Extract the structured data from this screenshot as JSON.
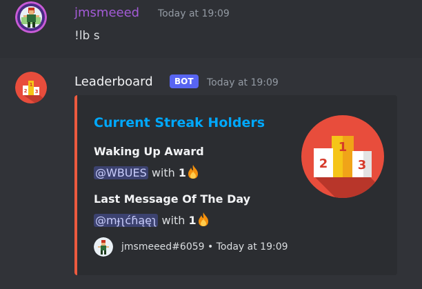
{
  "messages": [
    {
      "author": "jmsmeeed",
      "timestamp": "Today at 19:09",
      "content": "!lb s",
      "author_color": "#a35bd6"
    },
    {
      "author": "Leaderboard",
      "badge": "BOT",
      "timestamp": "Today at 19:09",
      "embed": {
        "accent_color": "#ed5a3f",
        "title": "Current Streak Holders",
        "fields": [
          {
            "name": "Waking Up Award",
            "mention": "@WBUES",
            "with_text": "with",
            "count": "1"
          },
          {
            "name": "Last Message Of The Day",
            "mention": "@mɟʅćɦąęʅ",
            "with_text": "with",
            "count": "1"
          }
        ],
        "footer": {
          "text": "jmsmeeed#6059 • Today at 19:09"
        }
      }
    }
  ],
  "podium": {
    "left": "2",
    "center": "1",
    "right": "3"
  },
  "icons": [
    "fire-icon",
    "podium-icon"
  ]
}
